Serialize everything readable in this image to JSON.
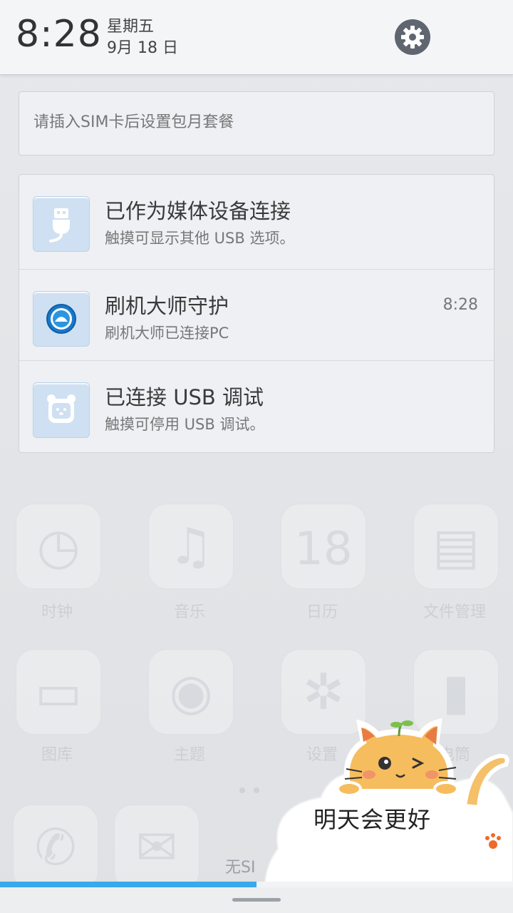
{
  "header": {
    "time": "8:28",
    "weekday": "星期五",
    "date": "9月 18 日",
    "settings_icon": "gear-icon"
  },
  "sim_card": {
    "text": "请插入SIM卡后设置包月套餐"
  },
  "notifications": [
    {
      "icon": "usb-plug-icon",
      "title": "已作为媒体设备连接",
      "subtitle": "触摸可显示其他 USB 选项。",
      "time": ""
    },
    {
      "icon": "shuaji-app-icon",
      "title": "刷机大师守护",
      "subtitle": "刷机大师已连接PC",
      "time": "8:28"
    },
    {
      "icon": "debug-bear-icon",
      "title": "已连接 USB 调试",
      "subtitle": "触摸可停用 USB 调试。",
      "time": ""
    }
  ],
  "background": {
    "apps_row1": [
      "时钟",
      "音乐",
      "日历",
      "文件管理"
    ],
    "apps_row2": [
      "图库",
      "主题",
      "设置",
      "电筒"
    ],
    "calendar_day": "18",
    "status_text": "无SI"
  },
  "bottom": {
    "progress": 0.5
  },
  "sticker": {
    "text": "明天会更好"
  },
  "colors": {
    "accent": "#37a9ec",
    "notification_icon_bg": "#cfe0f2",
    "gear_bg": "#5f6670"
  }
}
